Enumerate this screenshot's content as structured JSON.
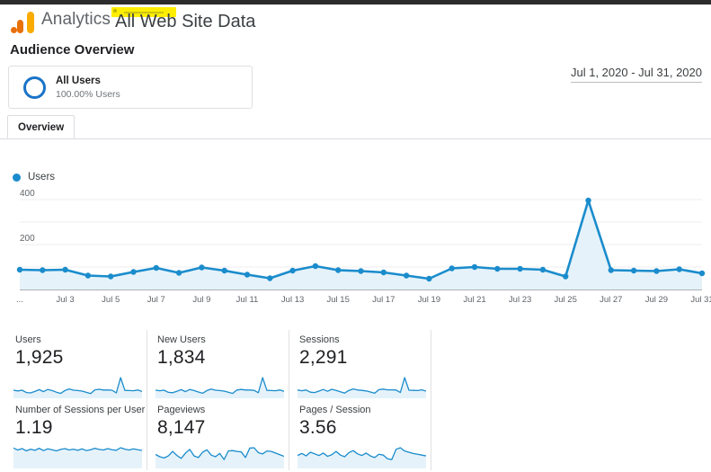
{
  "colors": {
    "brand_orange": "#e8710a",
    "brand_yellow": "#f9ab00",
    "line_blue": "#1a8ccc",
    "area_blue": "#e5f2fa",
    "segment_ring": "#1a73c8",
    "redaction_yellow": "#ffee00",
    "text_primary": "#202124",
    "text_secondary": "#70757a",
    "border": "#e0e0e0",
    "top_strip": "#2c2c2c"
  },
  "header": {
    "logo_name": "google-analytics-logo",
    "brand": "Analytics",
    "property": "All Web Site Data",
    "redaction_name": "redacted-account-name"
  },
  "page_title": "Audience Overview",
  "segment": {
    "name": "All Users",
    "percent": "100.00% Users",
    "ring_icon": "segment-ring-icon"
  },
  "date_range": "Jul 1, 2020 - Jul 31, 2020",
  "tabs": [
    {
      "label": "Overview",
      "active": true
    }
  ],
  "legend": [
    {
      "label": "Users",
      "color": "#1a8ccc"
    }
  ],
  "chart_data": {
    "type": "line",
    "title": "Users",
    "xlabel": "",
    "ylabel": "Users",
    "ylim": [
      0,
      400
    ],
    "yticks": [
      200,
      400
    ],
    "grid": true,
    "legend_position": "top-left",
    "area_fill": true,
    "x_tick_labels": [
      "...",
      "Jul 3",
      "Jul 5",
      "Jul 7",
      "Jul 9",
      "Jul 11",
      "Jul 13",
      "Jul 15",
      "Jul 17",
      "Jul 19",
      "Jul 21",
      "Jul 23",
      "Jul 25",
      "Jul 27",
      "Jul 29",
      "Jul 31"
    ],
    "categories": [
      "Jul 1",
      "Jul 2",
      "Jul 3",
      "Jul 4",
      "Jul 5",
      "Jul 6",
      "Jul 7",
      "Jul 8",
      "Jul 9",
      "Jul 10",
      "Jul 11",
      "Jul 12",
      "Jul 13",
      "Jul 14",
      "Jul 15",
      "Jul 16",
      "Jul 17",
      "Jul 18",
      "Jul 19",
      "Jul 20",
      "Jul 21",
      "Jul 22",
      "Jul 23",
      "Jul 24",
      "Jul 25",
      "Jul 26",
      "Jul 27",
      "Jul 28",
      "Jul 29",
      "Jul 30",
      "Jul 31"
    ],
    "series": [
      {
        "name": "Users",
        "color": "#1a8ccc",
        "values": [
          88,
          86,
          88,
          62,
          58,
          78,
          96,
          74,
          98,
          84,
          66,
          50,
          84,
          104,
          86,
          82,
          76,
          62,
          48,
          94,
          100,
          92,
          92,
          88,
          58,
          396,
          86,
          84,
          82,
          90,
          72
        ]
      }
    ]
  },
  "metric_cards": [
    [
      {
        "label": "Users",
        "value": "1,925",
        "sparkline": [
          30,
          26,
          30,
          17,
          15,
          23,
          33,
          22,
          34,
          28,
          19,
          12,
          28,
          37,
          30,
          28,
          25,
          18,
          11,
          32,
          35,
          31,
          31,
          30,
          15,
          100,
          29,
          28,
          27,
          31,
          23
        ]
      },
      {
        "label": "New Users",
        "value": "1,834",
        "sparkline": [
          30,
          27,
          30,
          18,
          16,
          24,
          33,
          22,
          34,
          28,
          20,
          13,
          28,
          36,
          30,
          28,
          25,
          19,
          12,
          31,
          34,
          31,
          31,
          29,
          16,
          100,
          29,
          28,
          27,
          31,
          24
        ]
      },
      {
        "label": "Sessions",
        "value": "2,291",
        "sparkline": [
          31,
          27,
          31,
          19,
          17,
          25,
          34,
          24,
          35,
          29,
          21,
          14,
          29,
          37,
          31,
          29,
          26,
          20,
          13,
          33,
          36,
          32,
          32,
          31,
          17,
          100,
          30,
          29,
          28,
          32,
          25
        ]
      }
    ],
    [
      {
        "label": "Number of Sessions per User",
        "value": "1.19",
        "sparkline": [
          62,
          55,
          60,
          52,
          58,
          54,
          61,
          53,
          59,
          56,
          52,
          57,
          60,
          55,
          58,
          54,
          59,
          53,
          56,
          61,
          57,
          55,
          60,
          56,
          54,
          63,
          58,
          55,
          59,
          56,
          54
        ]
      },
      {
        "label": "Pageviews",
        "value": "8,147",
        "sparkline": [
          55,
          44,
          38,
          48,
          70,
          50,
          36,
          62,
          80,
          48,
          40,
          66,
          78,
          52,
          44,
          60,
          30,
          72,
          74,
          70,
          68,
          40,
          86,
          88,
          64,
          58,
          72,
          70,
          62,
          54,
          46
        ]
      },
      {
        "label": "Pages / Session",
        "value": "3.56",
        "sparkline": [
          50,
          60,
          48,
          66,
          58,
          50,
          62,
          46,
          54,
          70,
          52,
          44,
          64,
          74,
          58,
          50,
          62,
          48,
          40,
          56,
          52,
          34,
          30,
          80,
          88,
          72,
          66,
          60,
          56,
          52,
          48
        ]
      }
    ]
  ]
}
